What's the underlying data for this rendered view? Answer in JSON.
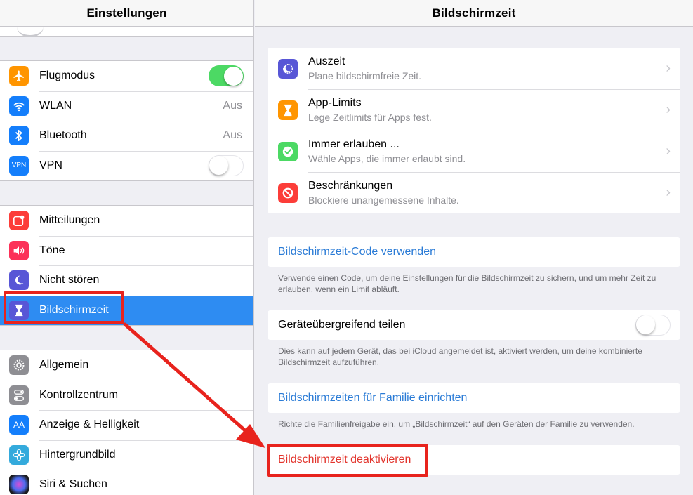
{
  "sidebar": {
    "title": "Einstellungen",
    "groups": [
      [
        {
          "label": "Flugmodus",
          "icon": "airplane-icon",
          "color": "#ff9500",
          "toggle": "on"
        },
        {
          "label": "WLAN",
          "icon": "wifi-icon",
          "color": "#147efb",
          "value": "Aus"
        },
        {
          "label": "Bluetooth",
          "icon": "bluetooth-icon",
          "color": "#147efb",
          "value": "Aus"
        },
        {
          "label": "VPN",
          "icon": "vpn-icon",
          "color": "#147efb",
          "toggle": "off",
          "icon_text": "VPN"
        }
      ],
      [
        {
          "label": "Mitteilungen",
          "icon": "notifications-icon",
          "color": "#fc3d39"
        },
        {
          "label": "Töne",
          "icon": "sounds-icon",
          "color": "#fc3158"
        },
        {
          "label": "Nicht stören",
          "icon": "moon-icon",
          "color": "#5856d6"
        },
        {
          "label": "Bildschirmzeit",
          "icon": "hourglass-icon",
          "color": "#5856d6",
          "selected": true
        }
      ],
      [
        {
          "label": "Allgemein",
          "icon": "gear-icon",
          "color": "#8e8e93"
        },
        {
          "label": "Kontrollzentrum",
          "icon": "control-center-icon",
          "color": "#8e8e93"
        },
        {
          "label": "Anzeige & Helligkeit",
          "icon": "display-icon",
          "color": "#147efb",
          "icon_text": "AA"
        },
        {
          "label": "Hintergrundbild",
          "icon": "wallpaper-icon",
          "color": "#34aadc"
        },
        {
          "label": "Siri & Suchen",
          "icon": "siri-icon",
          "color": "#1c1c1e"
        }
      ]
    ]
  },
  "detail": {
    "title": "Bildschirmzeit",
    "items": [
      {
        "title": "Auszeit",
        "subtitle": "Plane bildschirmfreie Zeit.",
        "icon": "downtime-icon",
        "color": "#5856d6"
      },
      {
        "title": "App-Limits",
        "subtitle": "Lege Zeitlimits für Apps fest.",
        "icon": "hourglass-icon",
        "color": "#ff9500"
      },
      {
        "title": "Immer erlauben ...",
        "subtitle": "Wähle Apps, die immer erlaubt sind.",
        "icon": "checkmark-icon",
        "color": "#4cd964"
      },
      {
        "title": "Beschränkungen",
        "subtitle": "Blockiere unangemessene Inhalte.",
        "icon": "restrict-icon",
        "color": "#fc3d39"
      }
    ],
    "code_link": "Bildschirmzeit-Code verwenden",
    "code_note": "Verwende einen Code, um deine Einstellungen für die Bildschirmzeit zu sichern, und um mehr Zeit zu erlauben, wenn ein Limit abläuft.",
    "share_label": "Geräteübergreifend teilen",
    "share_note": "Dies kann auf jedem Gerät, das bei iCloud angemeldet ist, aktiviert werden, um deine kombinierte Bildschirmzeit aufzuführen.",
    "family_link": "Bildschirmzeiten für Familie einrichten",
    "family_note": "Richte die Familienfreigabe ein, um „Bildschirmzeit“ auf den Geräten der Familie zu verwenden.",
    "disable_link": "Bildschirmzeit deaktivieren"
  },
  "colors": {
    "selected": "#2e8cf2",
    "link": "#2a7bd6",
    "danger": "#e2342c",
    "annotation": "#e8231d"
  }
}
